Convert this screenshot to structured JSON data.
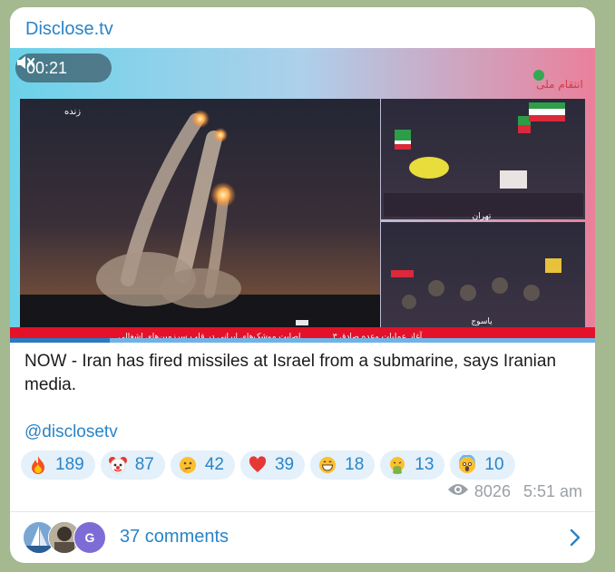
{
  "channel": {
    "name": "Disclose.tv"
  },
  "video": {
    "time": "00:21",
    "progress": 0.17,
    "overlay_live": "زنده",
    "overlay_logo": "انتقام ملی",
    "overlay_caption_main": "اصابت موشک‌های ایرانی در قلب سرزمین‌های اشغالی",
    "overlay_caption_side": "آغاز عملیات وعده صادق ۳",
    "overlay_city_top": "تهران",
    "overlay_city_bottom": "یاسوج"
  },
  "post": {
    "text": "NOW - Iran has fired missiles at Israel from a submarine, says Iranian media.",
    "mention": "@disclosetv"
  },
  "reactions": [
    {
      "icon": "fire-emoji",
      "count": "189"
    },
    {
      "icon": "clown-emoji",
      "count": "87"
    },
    {
      "icon": "thinking-emoji",
      "count": "42"
    },
    {
      "icon": "red-heart-emoji",
      "count": "39"
    },
    {
      "icon": "grinning-emoji",
      "count": "18"
    },
    {
      "icon": "vomiting-emoji",
      "count": "13"
    },
    {
      "icon": "screaming-emoji",
      "count": "10"
    }
  ],
  "meta": {
    "views": "8026",
    "time": "5:51 am"
  },
  "footer": {
    "comments": "37 comments",
    "avatar_letter": "G"
  },
  "colors": {
    "accent": "#2a84c6",
    "reaction_bg": "#e4f0fa",
    "meta": "#9aa0a6"
  }
}
